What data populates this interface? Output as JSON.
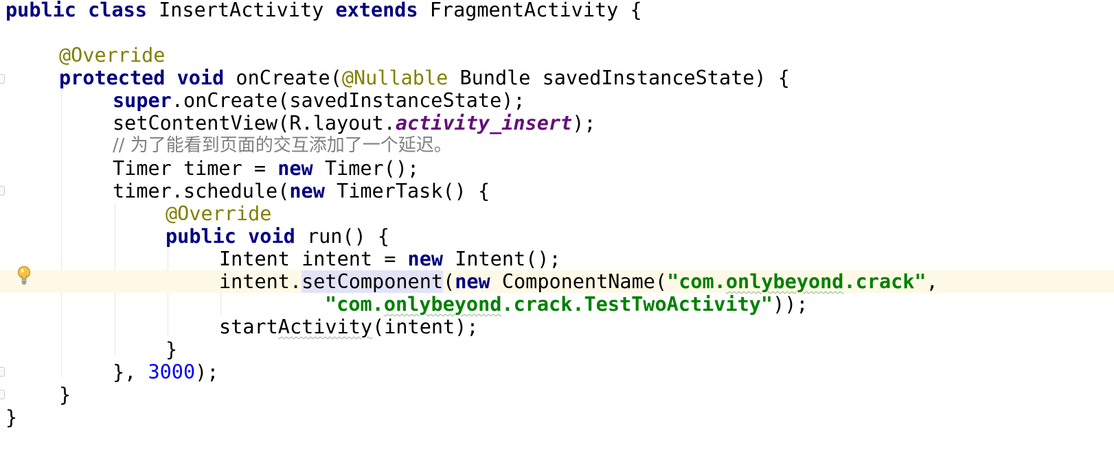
{
  "colors": {
    "keyword": "#000080",
    "annotation": "#808000",
    "string": "#008000",
    "number": "#0000ff",
    "comment": "#808080",
    "static_field": "#660e7a",
    "caret_line": "#fdf9e6",
    "usage_highlight": "#e3e3f8"
  },
  "gutter": {
    "intention_icon": "lightbulb-icon"
  },
  "code": {
    "l1": {
      "k1": "public",
      "k2": "class",
      "t1": "InsertActivity",
      "k3": "extends",
      "t2": "FragmentActivity {"
    },
    "l3": {
      "a1": "@Override"
    },
    "l4": {
      "k1": "protected",
      "k2": "void",
      "t1": "onCreate(",
      "a1": "@Nullable",
      "t2": "Bundle savedInstanceState) {"
    },
    "l5": {
      "k1": "super",
      "t1": ".onCreate(savedInstanceState);"
    },
    "l6": {
      "t1": "setContentView(R.layout.",
      "f1": "activity_insert",
      "t2": ");"
    },
    "l7": {
      "c1": "// 为了能看到页面的交互添加了一个延迟。"
    },
    "l8": {
      "t1": "Timer timer = ",
      "k1": "new",
      "t2": "Timer();"
    },
    "l9": {
      "t1": "timer.schedule(",
      "k1": "new",
      "t2": "TimerTask() {"
    },
    "l10": {
      "a1": "@Override"
    },
    "l11": {
      "k1": "public",
      "k2": "void",
      "t1": "run() {"
    },
    "l12": {
      "t1": "Intent intent = ",
      "k1": "new",
      "t2": "Intent();"
    },
    "l13": {
      "t1": "intent.",
      "u1": "setComponent",
      "t2": "(",
      "k1": "new",
      "t3": "ComponentName(",
      "s1q1": "\"",
      "s1a": "com.",
      "s1b": "onlybeyond",
      "s1c": ".crack",
      "s1q2": "\"",
      "t4": ","
    },
    "l14": {
      "s1q1": "\"",
      "s1a": "com.",
      "s1b": "onlybeyond",
      "s1c": ".crack.TestTwoActivity",
      "s1q2": "\"",
      "t1": "));"
    },
    "l15": {
      "t1": "start",
      "w1": "Activity",
      "t2": "(intent);"
    },
    "l16": {
      "t1": "}"
    },
    "l17": {
      "t1": "}, ",
      "n1": "3000",
      "t2": ");"
    },
    "l18": {
      "t1": "}"
    },
    "l19": {
      "t1": "}"
    }
  }
}
